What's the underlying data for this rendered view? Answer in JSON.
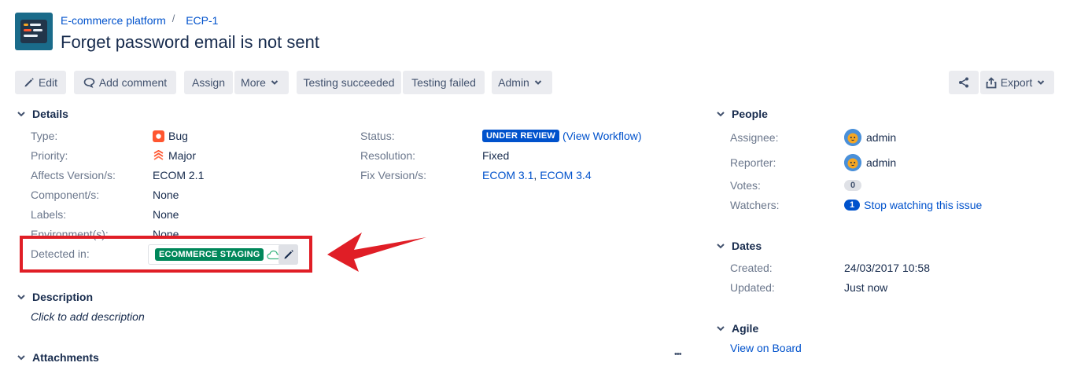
{
  "breadcrumb": {
    "project": "E-commerce platform",
    "separator": "/",
    "issue_key": "ECP-1"
  },
  "issue": {
    "title": "Forget password email is not sent"
  },
  "toolbar": {
    "edit": "Edit",
    "add_comment": "Add comment",
    "assign": "Assign",
    "more": "More",
    "testing_succeeded": "Testing succeeded",
    "testing_failed": "Testing failed",
    "admin": "Admin",
    "export": "Export"
  },
  "details": {
    "heading": "Details",
    "type_label": "Type:",
    "type_value": "Bug",
    "priority_label": "Priority:",
    "priority_value": "Major",
    "affects_label": "Affects Version/s:",
    "affects_value": "ECOM 2.1",
    "component_label": "Component/s:",
    "component_value": "None",
    "labels_label": "Labels:",
    "labels_value": "None",
    "environment_label": "Environment(s):",
    "environment_value": "None",
    "detected_label": "Detected in:",
    "detected_value": "ECOMMERCE STAGING",
    "status_label": "Status:",
    "status_value": "UNDER REVIEW",
    "view_workflow": "(View Workflow)",
    "resolution_label": "Resolution:",
    "resolution_value": "Fixed",
    "fix_label": "Fix Version/s:",
    "fix_value_1": "ECOM 3.1",
    "fix_sep": ",",
    "fix_value_2": "ECOM 3.4"
  },
  "description": {
    "heading": "Description",
    "placeholder": "Click to add description"
  },
  "attachments": {
    "heading": "Attachments",
    "more": "•••"
  },
  "people": {
    "heading": "People",
    "assignee_label": "Assignee:",
    "assignee_value": "admin",
    "reporter_label": "Reporter:",
    "reporter_value": "admin",
    "votes_label": "Votes:",
    "votes_count": "0",
    "watchers_label": "Watchers:",
    "watchers_count": "1",
    "watch_link": "Stop watching this issue"
  },
  "dates": {
    "heading": "Dates",
    "created_label": "Created:",
    "created_value": "24/03/2017 10:58",
    "updated_label": "Updated:",
    "updated_value": "Just now"
  },
  "agile": {
    "heading": "Agile",
    "view_on_board": "View on Board"
  },
  "colors": {
    "link": "#0052cc",
    "annotation_red": "#e01e26",
    "env_green": "#00875a",
    "status_blue": "#0052cc"
  }
}
